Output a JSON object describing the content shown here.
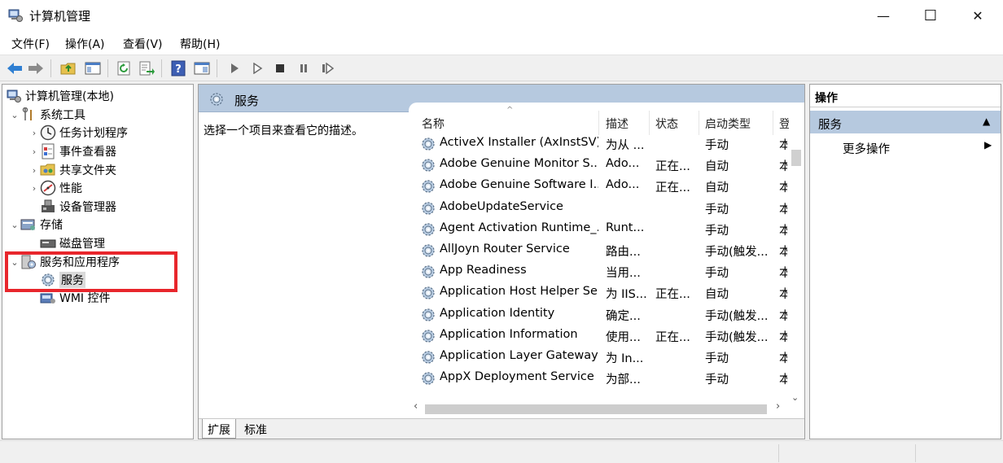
{
  "window": {
    "title": "计算机管理",
    "minimize": "—",
    "maximize": "☐",
    "close": "✕"
  },
  "menu": {
    "items": [
      "文件(F)",
      "操作(A)",
      "查看(V)",
      "帮助(H)"
    ]
  },
  "toolbar": {
    "buttons": [
      "back-icon",
      "forward-icon",
      "up-folder-icon",
      "show-hide-tree-icon",
      "refresh-icon",
      "export-list-icon",
      "help-icon",
      "properties-icon",
      "start-service-icon",
      "start-service-alt-icon",
      "stop-service-icon",
      "pause-service-icon",
      "restart-service-icon"
    ]
  },
  "tree": {
    "root": "计算机管理(本地)",
    "system_tools": "系统工具",
    "task_scheduler": "任务计划程序",
    "event_viewer": "事件查看器",
    "shared_folders": "共享文件夹",
    "performance": "性能",
    "device_manager": "设备管理器",
    "storage": "存储",
    "disk_management": "磁盘管理",
    "services_apps": "服务和应用程序",
    "services": "服务",
    "wmi_control": "WMI 控件"
  },
  "center": {
    "header_title": "服务",
    "description_prompt": "选择一个项目来查看它的描述。",
    "columns": [
      "名称",
      "描述",
      "状态",
      "启动类型",
      "登"
    ],
    "rows": [
      {
        "name": "ActiveX Installer (AxInstSV)",
        "desc": "为从 ...",
        "status": "",
        "startup": "手动",
        "logon": "本"
      },
      {
        "name": "Adobe Genuine Monitor S...",
        "desc": "Ado...",
        "status": "正在...",
        "startup": "自动",
        "logon": "本"
      },
      {
        "name": "Adobe Genuine Software I...",
        "desc": "Ado...",
        "status": "正在...",
        "startup": "自动",
        "logon": "本"
      },
      {
        "name": "AdobeUpdateService",
        "desc": "",
        "status": "",
        "startup": "手动",
        "logon": "本"
      },
      {
        "name": "Agent Activation Runtime_...",
        "desc": "Runt...",
        "status": "",
        "startup": "手动",
        "logon": "本"
      },
      {
        "name": "AllJoyn Router Service",
        "desc": "路由...",
        "status": "",
        "startup": "手动(触发...",
        "logon": "本"
      },
      {
        "name": "App Readiness",
        "desc": "当用...",
        "status": "",
        "startup": "手动",
        "logon": "本"
      },
      {
        "name": "Application Host Helper Se...",
        "desc": "为 IIS...",
        "status": "正在...",
        "startup": "自动",
        "logon": "本"
      },
      {
        "name": "Application Identity",
        "desc": "确定...",
        "status": "",
        "startup": "手动(触发...",
        "logon": "本"
      },
      {
        "name": "Application Information",
        "desc": "使用...",
        "status": "正在...",
        "startup": "手动(触发...",
        "logon": "本"
      },
      {
        "name": "Application Layer Gateway ...",
        "desc": "为 In...",
        "status": "",
        "startup": "手动",
        "logon": "本"
      },
      {
        "name": "AppX Deployment Service ...",
        "desc": "为部...",
        "status": "",
        "startup": "手动",
        "logon": "本"
      }
    ],
    "tabs": [
      "扩展",
      "标准"
    ]
  },
  "actions": {
    "header": "操作",
    "section": "服务",
    "more": "更多操作"
  },
  "colors": {
    "header_blue": "#b6c9df",
    "highlight_red": "#e8262c"
  }
}
